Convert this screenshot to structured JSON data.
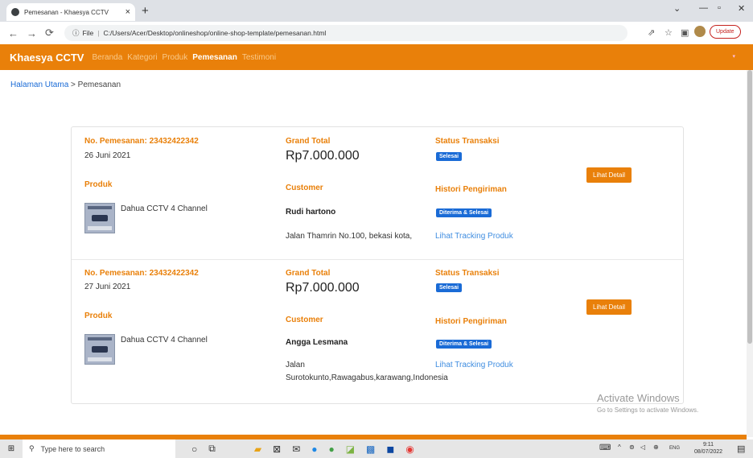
{
  "browser": {
    "tab_title": "Pemesanan - Khaesya CCTV",
    "url_prefix": "File",
    "url": "C:/Users/Acer/Desktop/onlineshop/online-shop-template/pemesanan.html",
    "update_label": "Update"
  },
  "navbar": {
    "brand": "Khaesya CCTV",
    "items": [
      "Beranda",
      "Kategori",
      "Produk",
      "Pemesanan",
      "Testimoni"
    ],
    "active_index": 3
  },
  "breadcrumb": {
    "home": "Halaman Utama",
    "separator": ">",
    "current": "Pemesanan"
  },
  "orders": [
    {
      "order_no": "No. Pemesanan: 23432422342",
      "date": "26 Juni 2021",
      "product_label": "Produk",
      "product_name": "Dahua CCTV 4 Channel",
      "grand_total_label": "Grand Total",
      "grand_total": "Rp7.000.000",
      "customer_label": "Customer",
      "customer_name": "Rudi hartono",
      "customer_address": "Jalan Thamrin No.100, bekasi kota,",
      "status_label": "Status Transaksi",
      "status": "Selesai",
      "history_label": "Histori Pengiriman",
      "history_status": "Diterima & Selesai",
      "tracking_link": "Lihat Tracking Produk",
      "detail_button": "Lihat Detail"
    },
    {
      "order_no": "No. Pemesanan: 23432422342",
      "date": "27 Juni 2021",
      "product_label": "Produk",
      "product_name": "Dahua CCTV 4 Channel",
      "grand_total_label": "Grand Total",
      "grand_total": "Rp7.000.000",
      "customer_label": "Customer",
      "customer_name": "Angga Lesmana",
      "customer_address_line1": "Jalan",
      "customer_address_line2": "Surotokunto,Rawagabus,karawang,Indonesia",
      "status_label": "Status Transaksi",
      "status": "Selesai",
      "history_label": "Histori Pengiriman",
      "history_status": "Diterima & Selesai",
      "tracking_link": "Lihat Tracking Produk",
      "detail_button": "Lihat Detail"
    }
  ],
  "watermark": {
    "line1": "Activate Windows",
    "line2": "Go to Settings to activate Windows."
  },
  "taskbar": {
    "search_placeholder": "Type here to search",
    "lang": "ENG",
    "time": "9:11",
    "date": "08/07/2022"
  },
  "colors": {
    "brand_orange": "#e9800a",
    "badge_blue": "#1a6bd6",
    "link_blue": "#3f8de0"
  }
}
